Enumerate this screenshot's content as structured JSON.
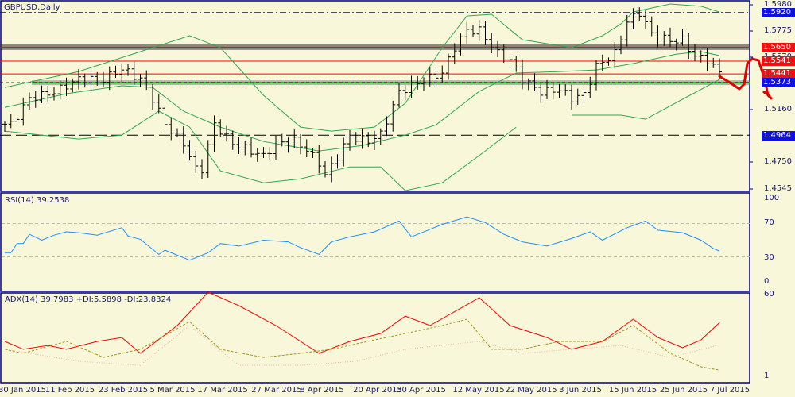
{
  "chart_data": [
    {
      "type": "ohlc",
      "title": "GBPUSD,Daily",
      "x_tick_labels": [
        "30 Jan 2015",
        "11 Feb 2015",
        "23 Feb 2015",
        "5 Mar 2015",
        "17 Mar 2015",
        "27 Mar 2015",
        "8 Apr 2015",
        "20 Apr 2015",
        "30 Apr 2015",
        "12 May 2015",
        "22 May 2015",
        "3 Jun 2015",
        "15 Jun 2015",
        "25 Jun 2015",
        "7 Jul 2015"
      ],
      "y_tick_labels": [
        "1.5980",
        "1.5775",
        "1.5570",
        "1.5160",
        "1.4750",
        "1.4545"
      ],
      "ylim": [
        1.4545,
        1.598
      ],
      "bar_count": 117,
      "close_keypoints": [
        [
          0,
          1.505
        ],
        [
          1,
          1.505
        ],
        [
          4,
          1.525
        ],
        [
          8,
          1.53
        ],
        [
          12,
          1.54
        ],
        [
          16,
          1.54
        ],
        [
          19,
          1.548
        ],
        [
          22,
          1.54
        ],
        [
          24,
          1.525
        ],
        [
          26,
          1.505
        ],
        [
          29,
          1.49
        ],
        [
          31,
          1.47
        ],
        [
          32,
          1.47
        ],
        [
          34,
          1.505
        ],
        [
          37,
          1.49
        ],
        [
          42,
          1.48
        ],
        [
          44,
          1.49
        ],
        [
          47,
          1.492
        ],
        [
          49,
          1.485
        ],
        [
          51,
          1.475
        ],
        [
          52,
          1.465
        ],
        [
          54,
          1.48
        ],
        [
          56,
          1.495
        ],
        [
          59,
          1.492
        ],
        [
          61,
          1.497
        ],
        [
          64,
          1.53
        ],
        [
          66,
          1.535
        ],
        [
          71,
          1.545
        ],
        [
          73,
          1.565
        ],
        [
          75,
          1.578
        ],
        [
          77,
          1.578
        ],
        [
          80,
          1.56
        ],
        [
          82,
          1.555
        ],
        [
          84,
          1.54
        ],
        [
          87,
          1.53
        ],
        [
          90,
          1.532
        ],
        [
          92,
          1.525
        ],
        [
          94,
          1.528
        ],
        [
          96,
          1.55
        ],
        [
          99,
          1.56
        ],
        [
          101,
          1.585
        ],
        [
          103,
          1.592
        ],
        [
          105,
          1.575
        ],
        [
          108,
          1.57
        ],
        [
          110,
          1.57
        ],
        [
          112,
          1.558
        ],
        [
          114,
          1.555
        ],
        [
          116,
          1.545
        ]
      ],
      "bollinger_upper": [
        [
          0,
          1.5336
        ],
        [
          12,
          1.546
        ],
        [
          22,
          1.5615
        ],
        [
          30,
          1.5739
        ],
        [
          35,
          1.5646
        ],
        [
          42,
          1.5274
        ],
        [
          48,
          1.5027
        ],
        [
          53,
          1.4996
        ],
        [
          60,
          1.5027
        ],
        [
          65,
          1.5213
        ],
        [
          71,
          1.5646
        ],
        [
          75,
          1.5893
        ],
        [
          79,
          1.5906
        ],
        [
          84,
          1.5708
        ],
        [
          92,
          1.5646
        ],
        [
          97,
          1.5739
        ],
        [
          100,
          1.5831
        ],
        [
          102,
          1.5924
        ],
        [
          108,
          1.5986
        ],
        [
          113,
          1.5968
        ],
        [
          116,
          1.5924
        ]
      ],
      "bollinger_middle": [
        [
          0,
          1.518
        ],
        [
          10,
          1.5287
        ],
        [
          19,
          1.5349
        ],
        [
          24,
          1.5336
        ],
        [
          29,
          1.5151
        ],
        [
          35,
          1.5027
        ],
        [
          42,
          1.4915
        ],
        [
          51,
          1.4841
        ],
        [
          58,
          1.4884
        ],
        [
          65,
          1.4965
        ],
        [
          70,
          1.5045
        ],
        [
          77,
          1.5305
        ],
        [
          83,
          1.5448
        ],
        [
          90,
          1.546
        ],
        [
          96,
          1.5472
        ],
        [
          102,
          1.5522
        ],
        [
          109,
          1.5596
        ],
        [
          113,
          1.5615
        ],
        [
          116,
          1.5584
        ]
      ],
      "bollinger_lower": [
        [
          0,
          1.4996
        ],
        [
          6,
          1.4965
        ],
        [
          12,
          1.4934
        ],
        [
          19,
          1.4965
        ],
        [
          25,
          1.5151
        ],
        [
          30,
          1.5027
        ],
        [
          35,
          1.4686
        ],
        [
          42,
          1.4593
        ],
        [
          48,
          1.4624
        ],
        [
          56,
          1.4717
        ],
        [
          61,
          1.4717
        ],
        [
          65,
          1.4532
        ],
        [
          71,
          1.4593
        ],
        [
          78,
          1.4841
        ],
        [
          83,
          1.5027
        ]
      ],
      "bollinger_lower_2": [
        [
          92,
          1.512
        ],
        [
          100,
          1.512
        ],
        [
          104,
          1.5089
        ],
        [
          110,
          1.5244
        ],
        [
          116,
          1.5398
        ]
      ],
      "levels": [
        {
          "price": "1.5920",
          "value": 1.592,
          "color": "#0000e0",
          "style": "dashdot"
        },
        {
          "price": "1.5650",
          "value": 1.565,
          "color": "#ff0000",
          "style": "solid-shadow"
        },
        {
          "price": "1.5541",
          "value": 1.5541,
          "color": "#ff0000",
          "style": "solid"
        },
        {
          "price": "1.5441",
          "value": 1.5441,
          "color": "#ff0000",
          "style": "solid"
        },
        {
          "price": "1.5373",
          "value": 1.5373,
          "color": "#0000e0",
          "style": "green-shadow"
        },
        {
          "price": "1.4964",
          "value": 1.4964,
          "color": "#0000e0",
          "style": "dashed"
        }
      ]
    },
    {
      "type": "line",
      "title": "RSI(14) 39.2538",
      "y_tick_labels": [
        "100",
        "70",
        "30",
        "0"
      ],
      "ylim": [
        0,
        100
      ],
      "levels": [
        70,
        30
      ],
      "series": [
        {
          "name": "RSI",
          "color": "#1e90ff",
          "points": [
            [
              0,
              35
            ],
            [
              1,
              35
            ],
            [
              2,
              46
            ],
            [
              3,
              46
            ],
            [
              4,
              57
            ],
            [
              6,
              50
            ],
            [
              8,
              56
            ],
            [
              10,
              60
            ],
            [
              12,
              59
            ],
            [
              15,
              56
            ],
            [
              19,
              65
            ],
            [
              20,
              55
            ],
            [
              22,
              51
            ],
            [
              25,
              33
            ],
            [
              26,
              38
            ],
            [
              30,
              26
            ],
            [
              33,
              35
            ],
            [
              35,
              46
            ],
            [
              38,
              43
            ],
            [
              42,
              50
            ],
            [
              46,
              48
            ],
            [
              48,
              41
            ],
            [
              51,
              33
            ],
            [
              53,
              48
            ],
            [
              56,
              54
            ],
            [
              60,
              60
            ],
            [
              64,
              73
            ],
            [
              66,
              54
            ],
            [
              71,
              69
            ],
            [
              75,
              78
            ],
            [
              78,
              71
            ],
            [
              81,
              57
            ],
            [
              84,
              48
            ],
            [
              88,
              43
            ],
            [
              92,
              52
            ],
            [
              95,
              60
            ],
            [
              97,
              50
            ],
            [
              101,
              65
            ],
            [
              104,
              73
            ],
            [
              106,
              62
            ],
            [
              110,
              59
            ],
            [
              113,
              50
            ],
            [
              115,
              40
            ],
            [
              116,
              37
            ]
          ]
        }
      ]
    },
    {
      "type": "line",
      "title": "ADX(14) 39.7983 +DI:5.5898 -DI:23.8324",
      "y_tick_labels": [
        "60",
        "1"
      ],
      "ylim": [
        0,
        60
      ],
      "series": [
        {
          "name": "ADX",
          "color": "#ff0000",
          "points": [
            [
              0,
              26.3
            ],
            [
              3,
              20.6
            ],
            [
              7,
              23.4
            ],
            [
              10,
              20.6
            ],
            [
              15,
              26.3
            ],
            [
              19,
              29.1
            ],
            [
              22,
              17.7
            ],
            [
              28,
              37.7
            ],
            [
              33,
              61.7
            ],
            [
              38,
              52
            ],
            [
              44,
              37.7
            ],
            [
              51,
              17.7
            ],
            [
              56,
              26.3
            ],
            [
              61,
              32
            ],
            [
              65,
              44.5
            ],
            [
              69,
              37.7
            ],
            [
              77,
              57.7
            ],
            [
              82,
              37.7
            ],
            [
              88,
              29.1
            ],
            [
              92,
              20.6
            ],
            [
              97,
              26.3
            ],
            [
              102,
              42.3
            ],
            [
              106,
              29.1
            ],
            [
              110,
              21.7
            ],
            [
              113,
              27.4
            ],
            [
              116,
              39.8
            ]
          ]
        },
        {
          "name": "+DI",
          "color": "#9a9a1a",
          "points": [
            [
              0,
              20.6
            ],
            [
              3,
              17.7
            ],
            [
              10,
              26.3
            ],
            [
              16,
              14.8
            ],
            [
              22,
              20.6
            ],
            [
              30,
              40.5
            ],
            [
              35,
              20.6
            ],
            [
              42,
              14.8
            ],
            [
              48,
              17.7
            ],
            [
              53,
              20.6
            ],
            [
              60,
              27.4
            ],
            [
              65,
              32
            ],
            [
              71,
              37.7
            ],
            [
              75,
              42.3
            ],
            [
              79,
              20.6
            ],
            [
              84,
              20.6
            ],
            [
              90,
              26.3
            ],
            [
              97,
              26.3
            ],
            [
              102,
              37.7
            ],
            [
              108,
              17.7
            ],
            [
              113,
              8
            ],
            [
              116,
              5.6
            ]
          ]
        },
        {
          "name": "-DI",
          "color": "#f0b0b0",
          "points": [
            [
              0,
              20.6
            ],
            [
              12,
              12
            ],
            [
              22,
              9.1
            ],
            [
              30,
              37.7
            ],
            [
              38,
              9.1
            ],
            [
              48,
              9.1
            ],
            [
              57,
              12
            ],
            [
              65,
              20.6
            ],
            [
              77,
              26.3
            ],
            [
              84,
              17.7
            ],
            [
              92,
              20.6
            ],
            [
              100,
              23.4
            ],
            [
              108,
              14.8
            ],
            [
              116,
              23.8
            ]
          ]
        }
      ]
    }
  ]
}
